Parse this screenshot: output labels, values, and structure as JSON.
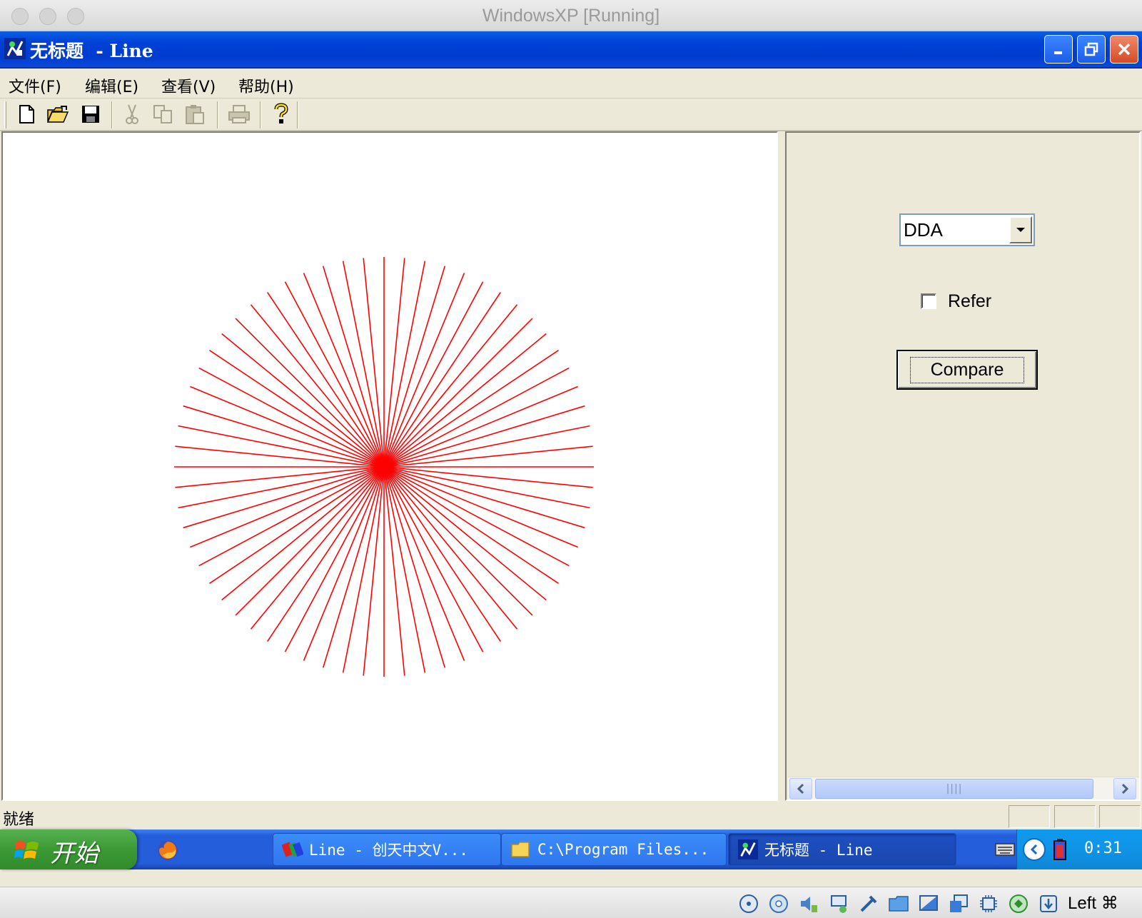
{
  "host_window": {
    "title": "WindowsXP [Running]"
  },
  "app_window": {
    "title": "无标题  - Line"
  },
  "menu": [
    {
      "label": "文件(F)"
    },
    {
      "label": "编辑(E)"
    },
    {
      "label": "查看(V)"
    },
    {
      "label": "帮助(H)"
    }
  ],
  "toolbar": {
    "icons": [
      "new-file-icon",
      "open-folder-icon",
      "save-icon",
      "cut-icon",
      "copy-icon",
      "paste-icon",
      "print-icon",
      "help-icon"
    ],
    "disabled": [
      "cut-icon",
      "copy-icon",
      "paste-icon",
      "print-icon"
    ]
  },
  "drawing": {
    "line_color": "#ff0000",
    "line_count": 64
  },
  "panel": {
    "algorithm": "DDA",
    "refer_label": "Refer",
    "refer_checked": false,
    "compare_label": "Compare",
    "scroll_thumb_grip": "||||"
  },
  "status": {
    "text": "就绪"
  },
  "taskbar": {
    "start_label": "开始",
    "tasks": [
      {
        "label": "Line - 创天中文V..."
      },
      {
        "label": "C:\\Program Files..."
      },
      {
        "label": "无标题 - Line"
      }
    ],
    "time": "0:31"
  },
  "vbox": {
    "host_key": "Left ⌘"
  },
  "colors": {
    "xp_title_blue": "#0042d6",
    "xp_face": "#ece9d8",
    "taskbar_blue": "#245edb",
    "start_green": "#3c9a35"
  }
}
